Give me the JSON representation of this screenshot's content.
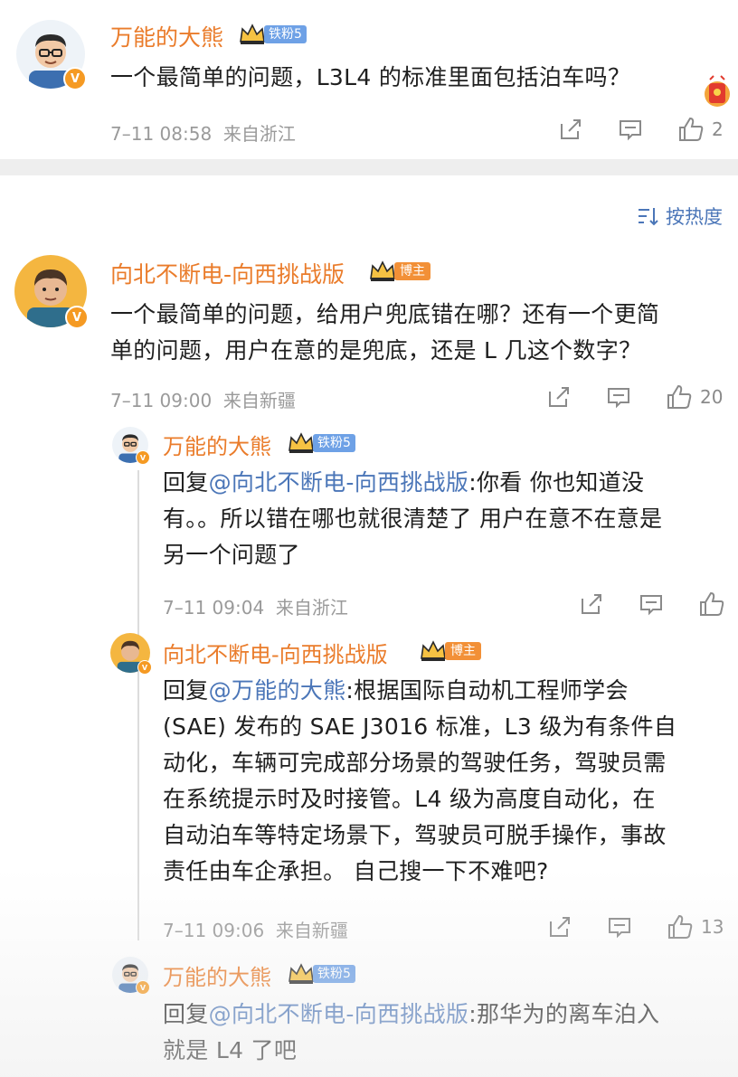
{
  "top_comment": {
    "user": "万能的大熊",
    "fan_badge": "铁粉5",
    "text": "一个最简单的问题，L3L4 的标准里面包括泊车吗？",
    "time": "7–11 08:58",
    "location": "来自浙江",
    "likes": "2"
  },
  "sort": {
    "label": "按热度",
    "icon": "sort-icon"
  },
  "comments": [
    {
      "user": "向北不断电-向西挑战版",
      "badge": "博主",
      "text_lines": [
        "一个最简单的问题，给用户兜底错在哪？还有一个更简",
        "单的问题，用户在意的是兜底，还是 L 几这个数字？"
      ],
      "time": "7–11 09:00",
      "location": "来自新疆",
      "likes": "20"
    }
  ],
  "replies": [
    {
      "user": "万能的大熊",
      "fan_badge": "铁粉5",
      "reply_prefix": "回复",
      "mention": "@向北不断电-向西挑战版",
      "text_first": ":你看 你也知道没",
      "text_lines": [
        "有。。所以错在哪也就很清楚了 用户在意不在意是",
        "另一个问题了"
      ],
      "time": "7–11 09:04",
      "location": "来自浙江",
      "likes": ""
    },
    {
      "user": "向北不断电-向西挑战版",
      "badge": "博主",
      "reply_prefix": "回复",
      "mention": "@万能的大熊",
      "text_first": ":根据国际自动机工程师学会",
      "text_lines": [
        "(SAE) 发布的 SAE J3016 标准，L3 级为有条件自",
        "动化，车辆可完成部分场景的驾驶任务，驾驶员需",
        "在系统提示时及时接管。L4 级为高度自动化，在",
        "自动泊车等特定场景下，驾驶员可脱手操作，事故",
        "责任由车企承担。 自己搜一下不难吧?"
      ],
      "time": "7–11 09:06",
      "location": "来自新疆",
      "likes": "13"
    },
    {
      "user": "万能的大熊",
      "fan_badge": "铁粉5",
      "reply_prefix": "回复",
      "mention": "@向北不断电-向西挑战版",
      "text_first": ":那华为的离车泊入",
      "text_lines": [
        "就是 L4 了吧"
      ]
    }
  ],
  "colors": {
    "username": "#ea7c2b",
    "mention": "#4b76b8",
    "meta": "#9a9a9a",
    "fan_badge": "#6ea1e6",
    "host_badge": "#f29037"
  }
}
